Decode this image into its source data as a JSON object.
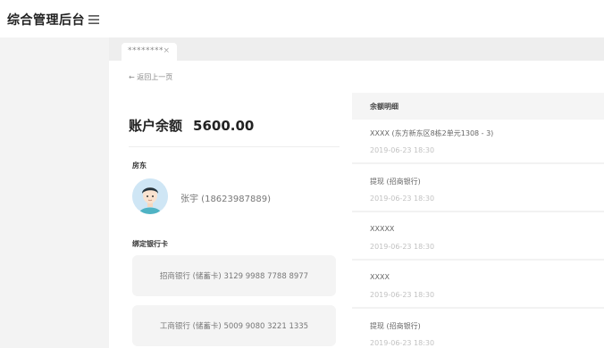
{
  "header": {
    "app_title": "综合管理后台"
  },
  "tab": {
    "label": "********",
    "close": "×"
  },
  "back_link": "← 返回上一页",
  "account": {
    "balance_label": "账户余额",
    "balance_value": "5600.00",
    "landlord_label": "房东",
    "landlord_name": "张宇 (18623987889)",
    "bank_label": "绑定银行卡",
    "cards": [
      "招商银行 (储蓄卡) 3129 9988 7788 8977",
      "工商银行 (储蓄卡) 5009 9080 3221 1335"
    ]
  },
  "detail": {
    "title": "余额明细",
    "rows": [
      {
        "desc": "XXXX (东方新东区8栋2单元1308 - 3)",
        "time": "2019-06-23 18:30"
      },
      {
        "desc": "提现 (招商银行)",
        "time": "2019-06-23 18:30"
      },
      {
        "desc": "XXXXX",
        "time": "2019-06-23 18:30"
      },
      {
        "desc": "XXXX",
        "time": "2019-06-23 18:30"
      },
      {
        "desc": "提现 (招商银行)",
        "time": "2019-06-23 18:30"
      }
    ]
  }
}
